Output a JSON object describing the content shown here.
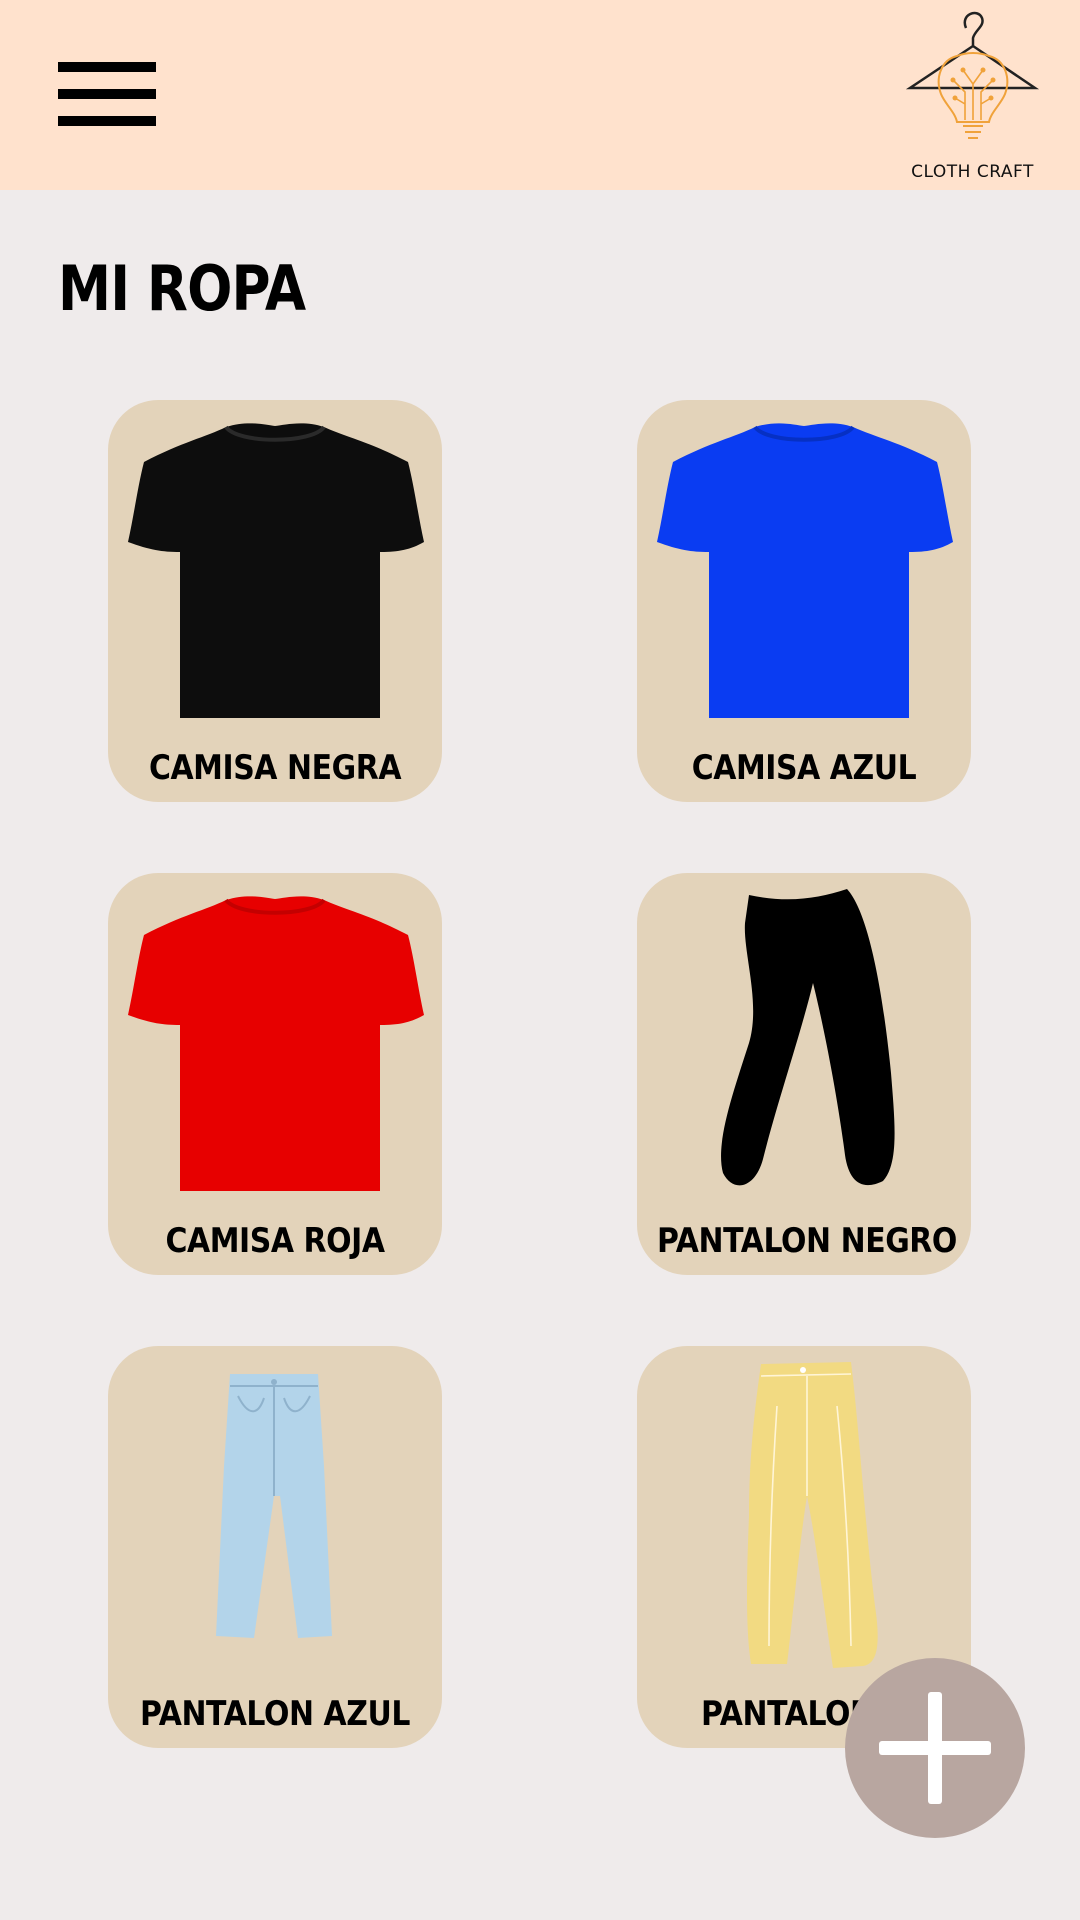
{
  "header": {
    "logo_text": "CLOTH CRAFT",
    "menu_icon": "hamburger-menu-icon",
    "logo_icon": "hanger-lightbulb-logo"
  },
  "page": {
    "title": "MI ROPA"
  },
  "items": [
    {
      "label": "CAMISA NEGRA",
      "icon": "tshirt-icon",
      "color": "#0d0d0d"
    },
    {
      "label": "CAMISA AZUL",
      "icon": "tshirt-icon",
      "color": "#0a3cf2"
    },
    {
      "label": "CAMISA ROJA",
      "icon": "tshirt-icon",
      "color": "#e70000"
    },
    {
      "label": "PANTALON NEGRO",
      "icon": "pants-icon",
      "color": "#000000"
    },
    {
      "label": "PANTALON AZUL",
      "icon": "jeans-icon",
      "color": "#b3d4ea"
    },
    {
      "label": "PANTALON B",
      "icon": "pants-icon",
      "color": "#f2da82"
    }
  ],
  "fab": {
    "icon": "plus-icon",
    "color": "#b8a6a0"
  },
  "colors": {
    "header_bg": "#ffe2cd",
    "page_bg": "#efebeb",
    "card_bg": "#e3d3ba",
    "logo_accent": "#f0a23a"
  }
}
